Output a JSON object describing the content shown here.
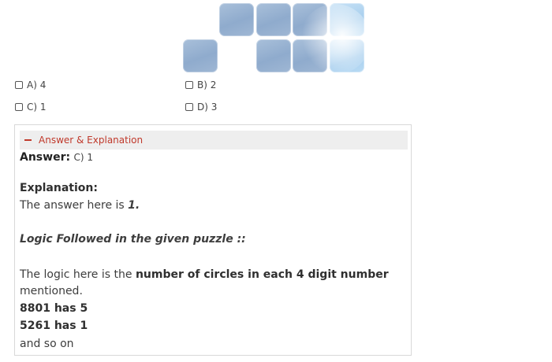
{
  "options": [
    {
      "label": "A) 4"
    },
    {
      "label": "B) 2"
    },
    {
      "label": "C) 1"
    },
    {
      "label": "D) 3"
    }
  ],
  "answer_toggle": {
    "label": "Answer & Explanation"
  },
  "answer": {
    "label": "Answer:",
    "value": "C) 1"
  },
  "explanation": {
    "heading": "Explanation:",
    "line1_prefix": "The answer here is ",
    "line1_value": "1.",
    "logic_heading": "Logic Followed in the given puzzle ::",
    "logic_prefix": "The logic here is the ",
    "logic_bold": "number of circles in each 4 digit number",
    "logic_suffix": "mentioned.",
    "example1": "8801 has 5",
    "example2": "5261 has 1",
    "tail": "and so on"
  }
}
